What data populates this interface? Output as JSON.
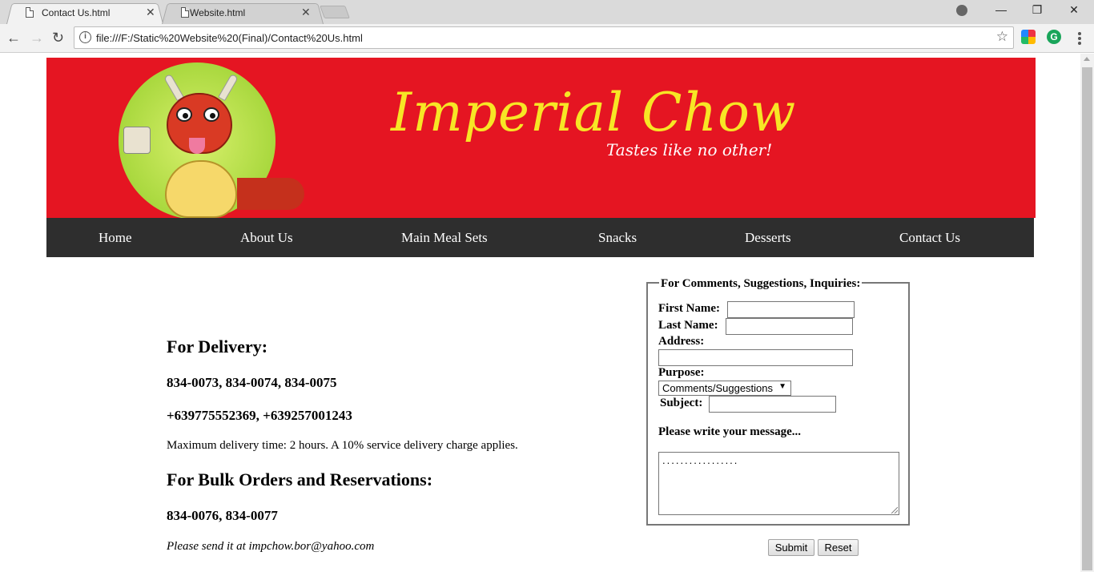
{
  "browser": {
    "tabs": [
      {
        "title": "Contact Us.html",
        "close": "✕"
      },
      {
        "title": "Website.html",
        "close": "✕"
      }
    ],
    "window_controls": {
      "minimize": "—",
      "restore": "❐",
      "close": "✕"
    },
    "nav": {
      "back": "←",
      "forward": "→",
      "reload": "↻"
    },
    "address_info": "i",
    "url": "file:///F:/Static%20Website%20(Final)/Contact%20Us.html",
    "bookmark_star": "☆",
    "extension_grammarly": "G"
  },
  "banner": {
    "brand": "Imperial Chow",
    "tagline": "Tastes like no other!",
    "colors": {
      "background": "#e51522",
      "brand_text": "#f7e625"
    }
  },
  "navbar": {
    "items": [
      "Home",
      "About Us",
      "Main Meal Sets",
      "Snacks",
      "Desserts",
      "Contact Us"
    ],
    "background": "#2e2e2e"
  },
  "contact": {
    "delivery_heading": "For Delivery:",
    "delivery_phones": "834-0073, 834-0074, 834-0075",
    "delivery_mobiles": "+639775552369, +639257001243",
    "delivery_note": "Maximum delivery time: 2 hours. A 10% service delivery charge applies.",
    "bulk_heading": "For Bulk Orders and Reservations:",
    "bulk_phones": "834-0076, 834-0077",
    "email_note": "Please send it at impchow.bor@yahoo.com"
  },
  "form": {
    "legend": "For Comments, Suggestions, Inquiries:",
    "first_name_label": "First Name:",
    "first_name_value": "",
    "last_name_label": "Last Name:",
    "last_name_value": "",
    "address_label": "Address:",
    "address_value": "",
    "purpose_label": "Purpose:",
    "purpose_selected": "Comments/Suggestions",
    "subject_label": "Subject:",
    "subject_value": "",
    "message_label": "Please write your message...",
    "message_value": ".................",
    "submit": "Submit",
    "reset": "Reset"
  }
}
